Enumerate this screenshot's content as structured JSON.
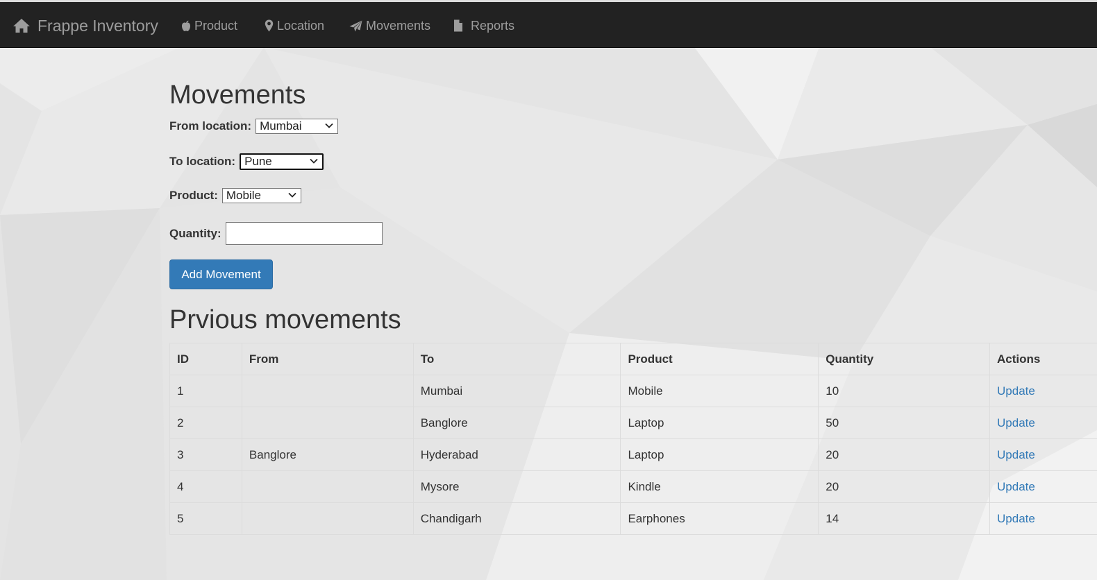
{
  "nav": {
    "brand": "Frappe Inventory",
    "items": [
      {
        "label": "Product",
        "icon": "apple-icon"
      },
      {
        "label": "Location",
        "icon": "map-marker-icon"
      },
      {
        "label": "Movements",
        "icon": "send-icon"
      },
      {
        "label": "Reports",
        "icon": "file-icon"
      }
    ]
  },
  "form": {
    "title": "Movements",
    "from_label": "From location:",
    "from_value": "Mumbai",
    "to_label": "To location:",
    "to_value": "Pune",
    "product_label": "Product:",
    "product_value": "Mobile",
    "quantity_label": "Quantity:",
    "quantity_value": "",
    "submit_label": "Add Movement"
  },
  "history": {
    "title": "Prvious movements",
    "columns": [
      "ID",
      "From",
      "To",
      "Product",
      "Quantity",
      "Actions"
    ],
    "rows": [
      {
        "id": "1",
        "from": "",
        "to": "Mumbai",
        "product": "Mobile",
        "quantity": "10",
        "action": "Update"
      },
      {
        "id": "2",
        "from": "",
        "to": "Banglore",
        "product": "Laptop",
        "quantity": "50",
        "action": "Update"
      },
      {
        "id": "3",
        "from": "Banglore",
        "to": "Hyderabad",
        "product": "Laptop",
        "quantity": "20",
        "action": "Update"
      },
      {
        "id": "4",
        "from": "",
        "to": "Mysore",
        "product": "Kindle",
        "quantity": "20",
        "action": "Update"
      },
      {
        "id": "5",
        "from": "",
        "to": "Chandigarh",
        "product": "Earphones",
        "quantity": "14",
        "action": "Update"
      }
    ]
  },
  "colors": {
    "navbar": "#222222",
    "nav_text": "#9d9d9d",
    "primary": "#337ab7",
    "link": "#337ab7"
  }
}
